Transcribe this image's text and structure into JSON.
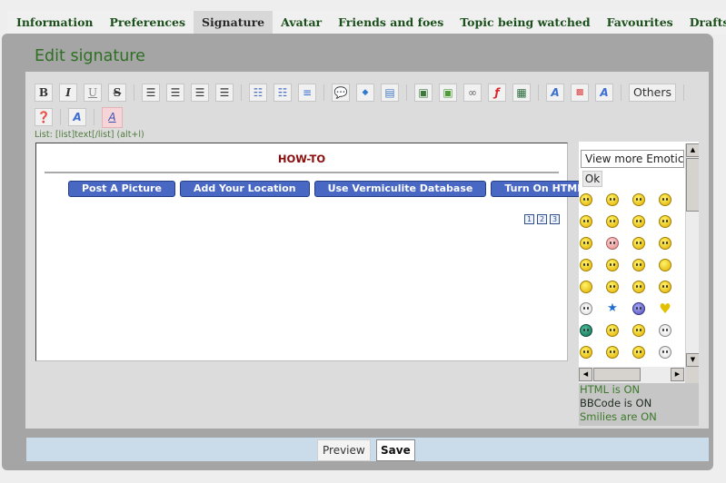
{
  "tabs": [
    {
      "label": "Information",
      "active": false
    },
    {
      "label": "Preferences",
      "active": false
    },
    {
      "label": "Signature",
      "active": true
    },
    {
      "label": "Avatar",
      "active": false
    },
    {
      "label": "Friends and foes",
      "active": false
    },
    {
      "label": "Topic being watched",
      "active": false
    },
    {
      "label": "Favourites",
      "active": false
    },
    {
      "label": "Drafts",
      "active": false
    }
  ],
  "page": {
    "title": "Edit signature"
  },
  "toolbar": {
    "bold": "B",
    "italic": "I",
    "underline": "U",
    "strike": "S",
    "others_label": "Others",
    "hint": "List: [list]text[/list] (alt+l)"
  },
  "editor": {
    "heading": "HOW-TO",
    "buttons": [
      "Post A Picture",
      "Add Your Location",
      "Use Vermiculite Database",
      "Turn On HTML"
    ],
    "pages": [
      "1",
      "2",
      "3"
    ]
  },
  "smilies": {
    "select_value": "View more Emoticons",
    "ok_label": "Ok"
  },
  "status": {
    "html": "HTML is ON",
    "bbcode": "BBCode is ON",
    "smilies": "Smilies are ON"
  },
  "actions": {
    "preview": "Preview",
    "save": "Save"
  },
  "colors": {
    "accent_green": "#2f6f24",
    "howto_red": "#8b0d0d",
    "howto_button": "#4868c4",
    "bottom_bar": "#cadbe9"
  }
}
